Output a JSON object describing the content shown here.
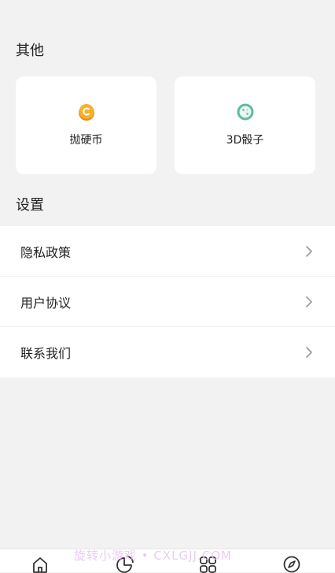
{
  "sections": {
    "other_title": "其他",
    "settings_title": "设置"
  },
  "tools": [
    {
      "label": "抛硬币",
      "icon": "coin-icon",
      "color": "#f4a21e"
    },
    {
      "label": "3D骰子",
      "icon": "dice-icon",
      "color": "#6cc3a6"
    }
  ],
  "settings": [
    {
      "label": "隐私政策"
    },
    {
      "label": "用户协议"
    },
    {
      "label": "联系我们"
    }
  ],
  "tabbar": [
    {
      "icon": "home-icon"
    },
    {
      "icon": "pie-chart-icon"
    },
    {
      "icon": "apps-grid-icon"
    },
    {
      "icon": "compass-icon"
    }
  ],
  "watermark": "旋转小游戏 • CXLGJJ.COM"
}
